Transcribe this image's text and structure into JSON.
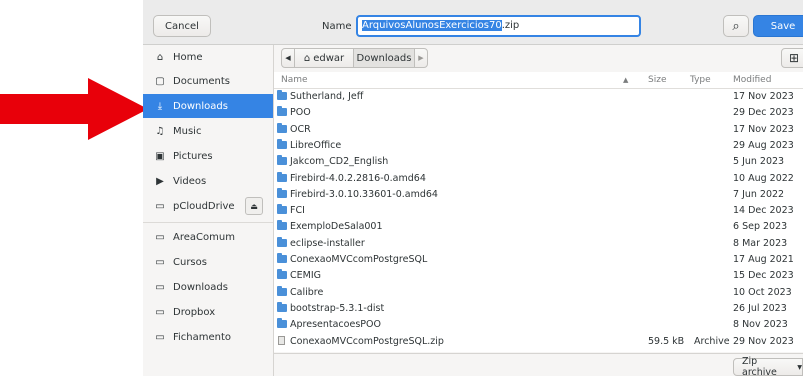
{
  "header": {
    "cancel_label": "Cancel",
    "name_label": "Name",
    "filename_selected": "ArquivosAlunosExercicios70",
    "filename_ext": ".zip",
    "save_label": "Save"
  },
  "sidebar": {
    "items": [
      {
        "icon": "home-icon",
        "glyph": "⌂",
        "label": "Home"
      },
      {
        "icon": "document-icon",
        "glyph": "▢",
        "label": "Documents"
      },
      {
        "icon": "download-icon",
        "glyph": "⤓",
        "label": "Downloads"
      },
      {
        "icon": "music-icon",
        "glyph": "♫",
        "label": "Music"
      },
      {
        "icon": "pictures-icon",
        "glyph": "▣",
        "label": "Pictures"
      },
      {
        "icon": "video-icon",
        "glyph": "▶",
        "label": "Videos"
      },
      {
        "icon": "drive-icon",
        "glyph": "▭",
        "label": "pCloudDrive"
      },
      {
        "icon": "folder-icon",
        "glyph": "▭",
        "label": "AreaComum"
      },
      {
        "icon": "folder-icon",
        "glyph": "▭",
        "label": "Cursos"
      },
      {
        "icon": "folder-icon",
        "glyph": "▭",
        "label": "Downloads"
      },
      {
        "icon": "folder-icon",
        "glyph": "▭",
        "label": "Dropbox"
      },
      {
        "icon": "folder-icon",
        "glyph": "▭",
        "label": "Fichamento"
      }
    ],
    "active_index": 2
  },
  "pathbar": {
    "back_glyph": "◀",
    "home_glyph": "⌂",
    "crumb_home": "edwar",
    "crumb_current": "Downloads",
    "forward_glyph": "▶"
  },
  "columns": {
    "name": "Name",
    "size": "Size",
    "type": "Type",
    "modified": "Modified"
  },
  "files": [
    {
      "name": "Sutherland, Jeff",
      "size": "",
      "type": "",
      "modified": "17 Nov 2023",
      "kind": "folder"
    },
    {
      "name": "POO",
      "size": "",
      "type": "",
      "modified": "29 Dec 2023",
      "kind": "folder"
    },
    {
      "name": "OCR",
      "size": "",
      "type": "",
      "modified": "17 Nov 2023",
      "kind": "folder"
    },
    {
      "name": "LibreOffice",
      "size": "",
      "type": "",
      "modified": "29 Aug 2023",
      "kind": "folder"
    },
    {
      "name": "Jakcom_CD2_English",
      "size": "",
      "type": "",
      "modified": "5 Jun 2023",
      "kind": "folder"
    },
    {
      "name": "Firebird-4.0.2.2816-0.amd64",
      "size": "",
      "type": "",
      "modified": "10 Aug 2022",
      "kind": "folder"
    },
    {
      "name": "Firebird-3.0.10.33601-0.amd64",
      "size": "",
      "type": "",
      "modified": "7 Jun 2022",
      "kind": "folder"
    },
    {
      "name": "FCI",
      "size": "",
      "type": "",
      "modified": "14 Dec 2023",
      "kind": "folder"
    },
    {
      "name": "ExemploDeSala001",
      "size": "",
      "type": "",
      "modified": "6 Sep 2023",
      "kind": "folder"
    },
    {
      "name": "eclipse-installer",
      "size": "",
      "type": "",
      "modified": "8 Mar 2023",
      "kind": "folder"
    },
    {
      "name": "ConexaoMVCcomPostgreSQL",
      "size": "",
      "type": "",
      "modified": "17 Aug 2021",
      "kind": "folder"
    },
    {
      "name": "CEMIG",
      "size": "",
      "type": "",
      "modified": "15 Dec 2023",
      "kind": "folder"
    },
    {
      "name": "Calibre",
      "size": "",
      "type": "",
      "modified": "10 Oct 2023",
      "kind": "folder"
    },
    {
      "name": "bootstrap-5.3.1-dist",
      "size": "",
      "type": "",
      "modified": "26 Jul 2023",
      "kind": "folder"
    },
    {
      "name": "ApresentacoesPOO",
      "size": "",
      "type": "",
      "modified": "8 Nov 2023",
      "kind": "folder"
    },
    {
      "name": "ConexaoMVCcomPostgreSQL.zip",
      "size": "59.5 kB",
      "type": "Archive",
      "modified": "29 Nov 2023",
      "kind": "file"
    }
  ],
  "filter": {
    "label": "Zip archive",
    "glyph": "▾"
  },
  "icons": {
    "search_glyph": "⌕",
    "new_folder_glyph": "⊞",
    "eject_glyph": "⏏",
    "sort_glyph": "▲"
  },
  "colors": {
    "accent": "#3584e4",
    "arrow": "#e8000a"
  }
}
